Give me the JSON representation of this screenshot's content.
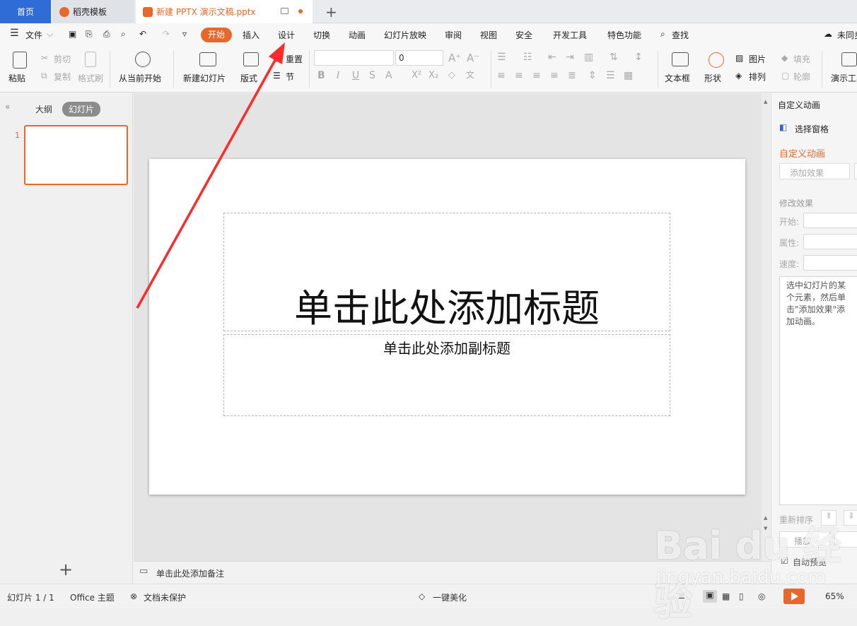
{
  "tabs": {
    "home": "首页",
    "template": "稻壳模板",
    "document": "新建 PPTX 演示文稿.pptx",
    "add": "+"
  },
  "menu": {
    "file": "文件",
    "items": [
      "开始",
      "插入",
      "设计",
      "切换",
      "动画",
      "幻灯片放映",
      "审阅",
      "视图",
      "安全",
      "开发工具",
      "特色功能"
    ],
    "search": "查找",
    "sync": "未同步"
  },
  "ribbon": {
    "paste": "粘贴",
    "cut": "剪切",
    "copy": "复制",
    "format_painter": "格式刷",
    "from_current": "从当前开始",
    "new_slide": "新建幻灯片",
    "layout": "版式",
    "reset": "重置",
    "section": "节",
    "font_size": "0",
    "text_box": "文本框",
    "shape": "形状",
    "picture": "图片",
    "fill": "填充",
    "arrange": "排列",
    "outline": "轮廓",
    "presentation_tools": "演示工具"
  },
  "left_pane": {
    "outline_tab": "大纲",
    "slides_tab": "幻灯片",
    "slide_number": "1",
    "add_slide": "+"
  },
  "slide": {
    "title_placeholder": "单击此处添加标题",
    "subtitle_placeholder": "单击此处添加副标题"
  },
  "notes_placeholder": "单击此处添加备注",
  "right_pane": {
    "header": "自定义动画",
    "selection_pane": "选择窗格",
    "section_title": "自定义动画",
    "add_effect": "添加效果",
    "modify_effect": "修改效果",
    "start_label": "开始:",
    "property_label": "属性:",
    "speed_label": "速度:",
    "hint": "选中幻灯片的某个元素，然后单击\"添加效果\"添加动画。",
    "reorder": "重新排序",
    "play": "播放",
    "auto_preview": "自动预览"
  },
  "status": {
    "slide_count": "幻灯片 1 / 1",
    "theme": "Office 主题",
    "protection": "文档未保护",
    "beautify": "一键美化",
    "zoom": "65%"
  },
  "watermark": {
    "text": "Bai du 经验",
    "url": "jingyan.baidu.com"
  },
  "colors": {
    "accent": "#e8672a",
    "home_tab": "#2f6cd6",
    "arrow": "#ff2a2a"
  }
}
